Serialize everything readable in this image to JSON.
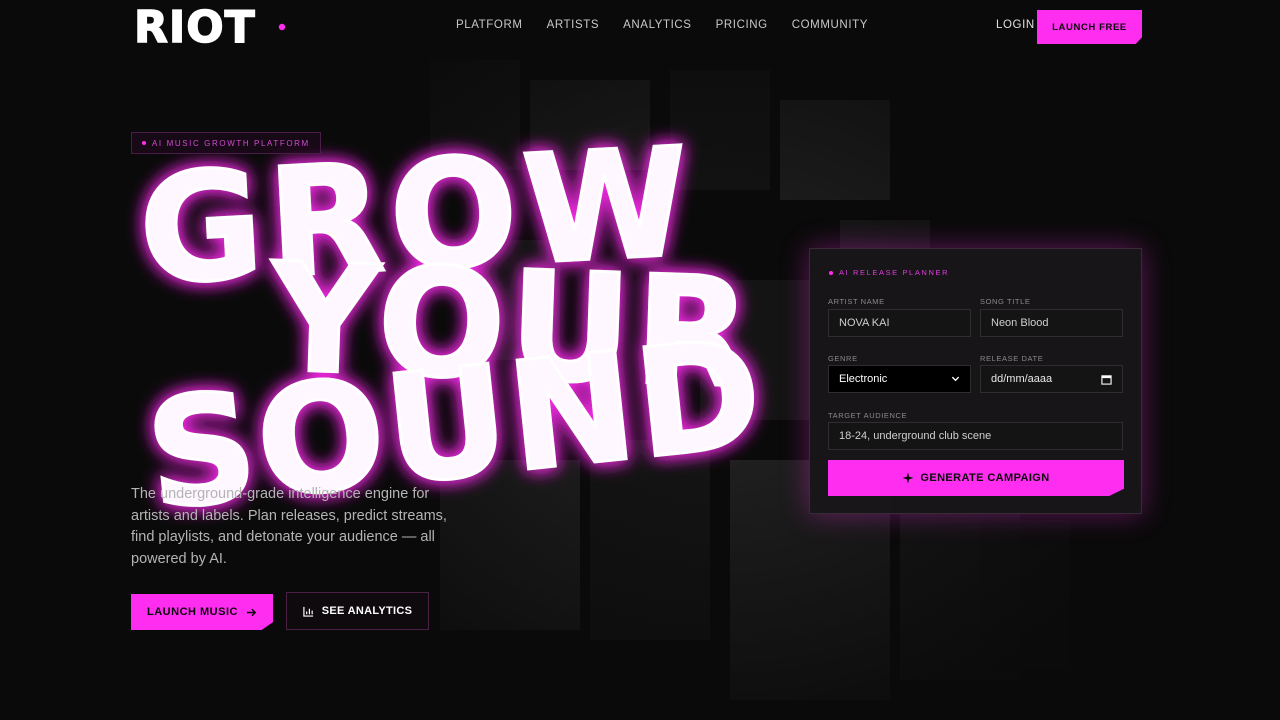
{
  "brand": {
    "logo_text": "RIOT",
    "accent": "#ff2df0"
  },
  "nav": {
    "links": [
      "PLATFORM",
      "ARTISTS",
      "ANALYTICS",
      "PRICING",
      "COMMUNITY"
    ],
    "login": "LOGIN",
    "cta": "LAUNCH FREE"
  },
  "hero": {
    "badge": "AI MUSIC GROWTH PLATFORM",
    "headline_lines": [
      "GROW",
      "YOUR",
      "SOUND"
    ],
    "copy": "The underground-grade intelligence engine for artists and labels. Plan releases, predict streams, find playlists, and detonate your audience — all powered by AI.",
    "primary_button": "LAUNCH MUSIC",
    "secondary_button": "SEE ANALYTICS"
  },
  "planner": {
    "title": "AI RELEASE PLANNER",
    "artist_label": "ARTIST NAME",
    "artist_value": "NOVA KAI",
    "song_label": "SONG TITLE",
    "song_value": "Neon Blood",
    "genre_label": "GENRE",
    "genre_value": "Electronic",
    "date_label": "RELEASE DATE",
    "date_placeholder": "dd/mm/aaaa",
    "audience_label": "TARGET AUDIENCE",
    "audience_value": "18-24, underground club scene",
    "generate_button": "GENERATE CAMPAIGN"
  },
  "icons": {
    "arrow": "arrow-right-icon",
    "analytics": "bar-chart-icon",
    "calendar": "calendar-icon",
    "sparkle": "sparkle-icon",
    "caret": "chevron-down-icon"
  }
}
